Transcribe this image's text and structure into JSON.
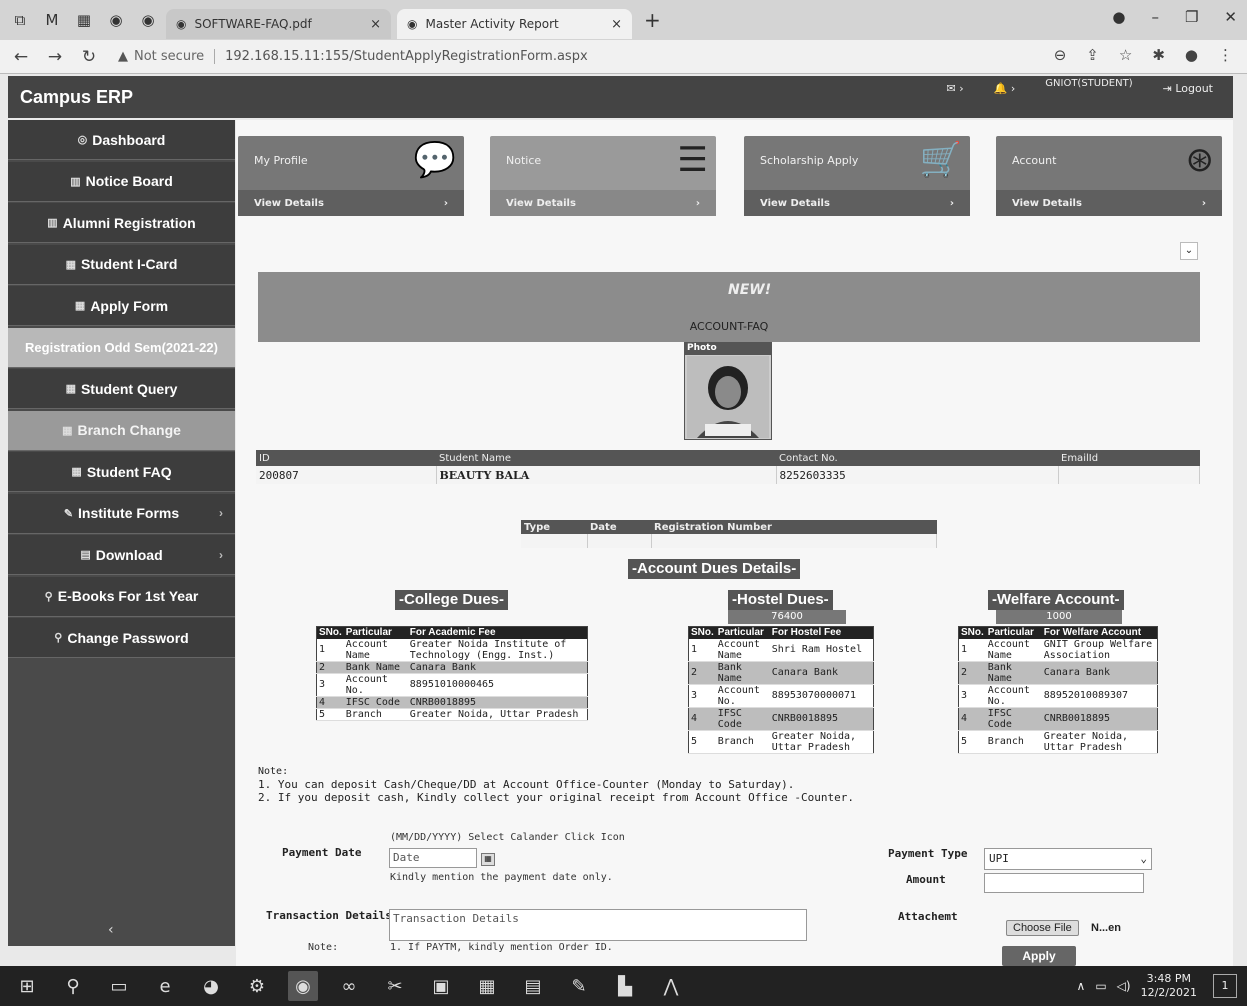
{
  "browser": {
    "tabs": [
      {
        "title": "SOFTWARE-FAQ.pdf",
        "close": "×"
      },
      {
        "title": "Master Activity Report",
        "close": "×"
      }
    ],
    "new_tab": "+",
    "not_secure": "Not secure",
    "url": "192.168.15.11:155/StudentApplyRegistrationForm.aspx"
  },
  "header": {
    "brand": "Campus ERP",
    "user": "GNIOT(STUDENT)",
    "logout": "Logout"
  },
  "sidebar": {
    "items": [
      {
        "label": "Dashboard",
        "icon": "dashboard-icon"
      },
      {
        "label": "Notice Board",
        "icon": "chart-icon"
      },
      {
        "label": "Alumni Registration",
        "icon": "chart-icon"
      },
      {
        "label": "Student I-Card",
        "icon": "grid-icon"
      },
      {
        "label": "Apply Form",
        "icon": "grid-icon"
      },
      {
        "label": "Registration Odd Sem(2021-22)",
        "icon": ""
      },
      {
        "label": "Student Query",
        "icon": "grid-icon"
      },
      {
        "label": "Branch Change",
        "icon": "grid-icon"
      },
      {
        "label": "Student FAQ",
        "icon": "grid-icon"
      },
      {
        "label": "Institute Forms",
        "icon": "wrench-icon"
      },
      {
        "label": "Download",
        "icon": "file-icon"
      },
      {
        "label": "E-Books For 1st Year",
        "icon": "link-icon"
      },
      {
        "label": "Change Password",
        "icon": "link-icon"
      }
    ],
    "collapse": "‹"
  },
  "cards": [
    {
      "title": "My Profile",
      "link": "View Details"
    },
    {
      "title": "Notice",
      "link": "View Details"
    },
    {
      "title": "Scholarship Apply",
      "link": "View Details"
    },
    {
      "title": "Account",
      "link": "View Details"
    }
  ],
  "banner": {
    "badge": "NEW!",
    "text": "ACCOUNT-FAQ"
  },
  "photo": {
    "label": "Photo"
  },
  "student": {
    "headers": [
      "ID",
      "Student Name",
      "Contact No.",
      "EmailId"
    ],
    "id": "200807",
    "name": "BEAUTY BALA",
    "contact": "8252603335",
    "email": ""
  },
  "registration": {
    "headers": [
      "Type",
      "Date",
      "Registration Number"
    ]
  },
  "dues": {
    "title": "-Account Dues Details-",
    "college": {
      "title": "-College Dues-",
      "headers": [
        "SNo.",
        "Particular",
        "For Academic Fee"
      ],
      "rows": [
        [
          "1",
          "Account Name",
          "Greater Noida Institute of Technology (Engg. Inst.)"
        ],
        [
          "2",
          "Bank Name",
          "Canara Bank"
        ],
        [
          "3",
          "Account No.",
          "88951010000465"
        ],
        [
          "4",
          "IFSC Code",
          "CNRB0018895"
        ],
        [
          "5",
          "Branch",
          "Greater Noida, Uttar Pradesh"
        ]
      ]
    },
    "hostel": {
      "title": "-Hostel Dues-",
      "amount": "76400",
      "headers": [
        "SNo.",
        "Particular",
        "For Hostel Fee"
      ],
      "rows": [
        [
          "1",
          "Account Name",
          "Shri Ram Hostel"
        ],
        [
          "2",
          "Bank Name",
          "Canara Bank"
        ],
        [
          "3",
          "Account No.",
          "88953070000071"
        ],
        [
          "4",
          "IFSC Code",
          "CNRB0018895"
        ],
        [
          "5",
          "Branch",
          "Greater Noida, Uttar Pradesh"
        ]
      ]
    },
    "welfare": {
      "title": "-Welfare Account-",
      "amount": "1000",
      "headers": [
        "SNo.",
        "Particular",
        "For Welfare Account"
      ],
      "rows": [
        [
          "1",
          "Account Name",
          "GNIT Group Welfare Association"
        ],
        [
          "2",
          "Bank Name",
          "Canara Bank"
        ],
        [
          "3",
          "Account No.",
          "88952010089307"
        ],
        [
          "4",
          "IFSC Code",
          "CNRB0018895"
        ],
        [
          "5",
          "Branch",
          "Greater Noida, Uttar Pradesh"
        ]
      ]
    }
  },
  "notes": {
    "title": "Note:",
    "lines": [
      "1. You can deposit Cash/Cheque/DD at Account Office-Counter (Monday to Saturday).",
      "2. If you deposit cash, Kindly collect your original receipt from Account Office -Counter."
    ]
  },
  "form": {
    "payment_date_label": "Payment Date",
    "date_hint": "(MM/DD/YYYY) Select Calander Click Icon",
    "date_placeholder": "Date",
    "date_note": "Kindly mention the payment date only.",
    "payment_type_label": "Payment Type",
    "payment_type_value": "UPI",
    "amount_label": "Amount",
    "transaction_label": "Transaction Details",
    "transaction_placeholder": "Transaction Details",
    "attachment_label": "Attachemt",
    "choose_file": "Choose File",
    "file_name": "N...en",
    "note_label": "Note:",
    "note_text": "1. If PAYTM, kindly mention Order ID.",
    "apply": "Apply"
  },
  "taskbar": {
    "time": "3:48 PM",
    "date": "12/2/2021",
    "notifications": "1"
  }
}
